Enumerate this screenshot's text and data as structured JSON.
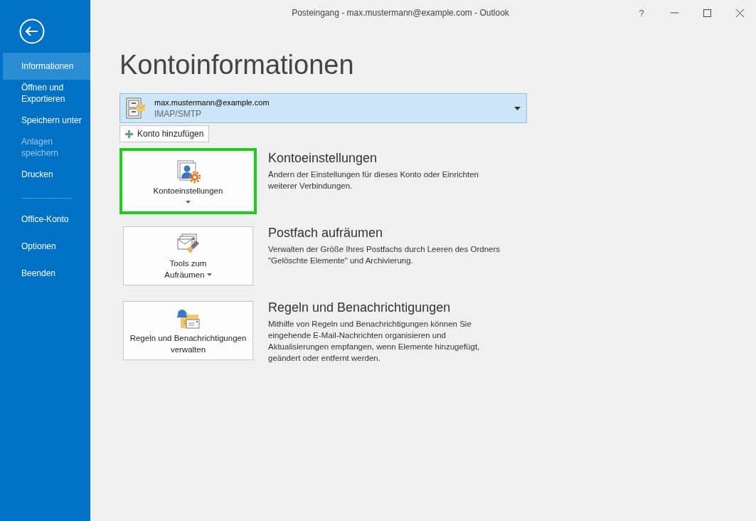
{
  "window": {
    "title": "Posteingang - max.mustermann@example.com - Outlook",
    "help": "?"
  },
  "sidebar": {
    "items": [
      {
        "label": "Informationen",
        "selected": true,
        "disabled": false,
        "divider_before": false
      },
      {
        "label": "Öffnen und Exportieren",
        "selected": false,
        "disabled": false,
        "divider_before": false
      },
      {
        "label": "Speichern unter",
        "selected": false,
        "disabled": false,
        "divider_before": false
      },
      {
        "label": "Anlagen speichern",
        "selected": false,
        "disabled": true,
        "divider_before": false
      },
      {
        "label": "Drucken",
        "selected": false,
        "disabled": false,
        "divider_before": false
      },
      {
        "label": "Office-Konto",
        "selected": false,
        "disabled": false,
        "divider_before": true
      },
      {
        "label": "Optionen",
        "selected": false,
        "disabled": false,
        "divider_before": false
      },
      {
        "label": "Beenden",
        "selected": false,
        "disabled": false,
        "divider_before": false
      }
    ]
  },
  "page_title": "Kontoinformationen",
  "account": {
    "email": "max.mustermann@example.com",
    "type": "IMAP/SMTP"
  },
  "add_account": "Konto hinzufügen",
  "actions": [
    {
      "kind": "account-settings",
      "button": "Kontoeinstellungen",
      "dropdown": true,
      "highlighted": true,
      "heading": "Kontoeinstellungen",
      "description": "Ändern der Einstellungen für dieses Konto oder Einrichten weiterer Verbindungen."
    },
    {
      "kind": "cleanup",
      "button": "Tools zum Aufräumen",
      "dropdown": true,
      "highlighted": false,
      "heading": "Postfach aufräumen",
      "description": "Verwalten der Größe Ihres Postfachs durch Leeren des Ordners \"Gelöschte Elemente\" und Archivierung."
    },
    {
      "kind": "rules",
      "button": "Regeln und Benachrichtigungen verwalten",
      "dropdown": false,
      "highlighted": false,
      "heading": "Regeln und Benachrichtigungen",
      "description": "Mithilfe von Regeln und Benachrichtigungen können Sie eingehende E-Mail-Nachrichten organisieren und Aktualisierungen empfangen, wenn Elemente hinzugefügt, geändert oder entfernt werden."
    }
  ]
}
